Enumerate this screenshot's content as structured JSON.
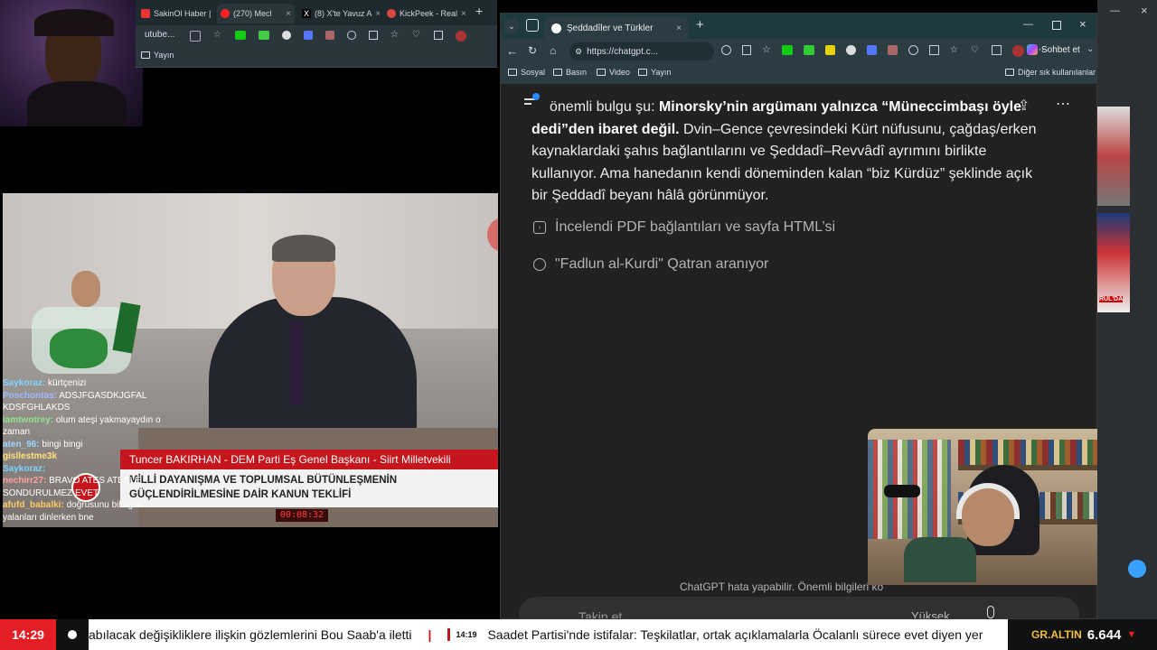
{
  "left_browser": {
    "tabs": [
      {
        "label": "SakinOl Haber |"
      },
      {
        "label": "(270) Mecl"
      },
      {
        "label": "(8) X'te Yavuz A"
      },
      {
        "label": "KickPeek - Real"
      }
    ],
    "address_partial": "utube...",
    "bookmark": "Yayın"
  },
  "tv": {
    "name_banner": "Tuncer BAKIRHAN - DEM Parti Eş Genel Başkanı - Siirt Milletvekili",
    "subtitle_line1": "MİLLİ DAYANIŞMA VE TOPLUMSAL BÜTÜNLEŞMENİN",
    "subtitle_line2": "GÜÇLENDİRİLMESİNE DAİR KANUN TEKLİFİ",
    "timer": "00:08:32"
  },
  "chat": [
    {
      "user": "Saykoraz:",
      "text": "kürtçenizi",
      "color": "#7cd3ff"
    },
    {
      "user": "Poschontas:",
      "text": "ADSJFGASDKJGFAL KDSFGHLAKDS",
      "color": "#9db9ff"
    },
    {
      "user": "iamtwotrey:",
      "text": "olum ateşi yakmayaydın o zaman",
      "color": "#8fe38f"
    },
    {
      "user": "aten_96:",
      "text": "bingi bingi",
      "color": "#9ad6ff"
    },
    {
      "user": "gisllestme3k",
      "text": "",
      "color": "#ffe27a"
    },
    {
      "user": "Saykoraz:",
      "text": "",
      "color": "#7cd3ff"
    },
    {
      "user": "nechirr27:",
      "text": "BRAVO ATES ATESLE SONDURULMEZ EVET",
      "color": "#ff9f9f"
    },
    {
      "user": "afufd_babalki:",
      "text": "doğrusunu bildiğim yalanları dinlerken bne",
      "color": "#ffcc66"
    }
  ],
  "chatgpt_window": {
    "tab_title": "Şeddadîler ve Türkler",
    "url": "https://chatgpt.c...",
    "chat_button": "Sohbet et",
    "bookmarks": [
      "Sosyal",
      "Basın",
      "Video",
      "Yayın"
    ],
    "other_bookmarks": "Diğer sık kullanılanlar",
    "para_lead": "önemli bulgu şu: ",
    "para_bold": "Minorsky’nin argümanı yalnızca “Müneccimbaşı öyle dedi”den ibaret değil.",
    "para_rest": " Dvin–Gence çevresindeki Kürt nüfusunu, çağdaş/erken kaynaklardaki şahıs bağlantılarını ve Şeddadî–Revvâdî ayrımını birlikte kullanıyor. Ama hanedanın kendi döneminden kalan “biz Kürdüz” şeklinde açık bir Şeddadî beyanı hâlâ görünmüyor.",
    "steps": [
      {
        "icon": "terminal-icon",
        "text": "İncelendi PDF bağlantıları ve sayfa HTML’si"
      },
      {
        "icon": "globe-icon",
        "text": "\"Fadlun al-Kurdi\" Qatran aranıyor"
      }
    ],
    "disclaimer": "ChatGPT hata yapabilir. Önemli bilgileri ko",
    "composer_placeholder": "Takip et",
    "model_label": "Yüksek"
  },
  "ticker": {
    "time": "14:29",
    "headline1": "abılacak değişikliklere ilişkin gözlemlerini Bou Saab'a iletti",
    "time2": "14:19",
    "headline2": "Saadet Partisi'nde istifalar: Teşkilatlar, ortak açıklamalarla Öcalanlı sürece evet diyen yer",
    "gold_label": "GR.ALTIN",
    "gold_value": "6.644"
  },
  "right_strip": {
    "label1": "RUL'DA"
  },
  "colors": {
    "ticker_red": "#e31e24",
    "tv_banner_red": "#c4161c",
    "chatgpt_bg": "#212121"
  }
}
